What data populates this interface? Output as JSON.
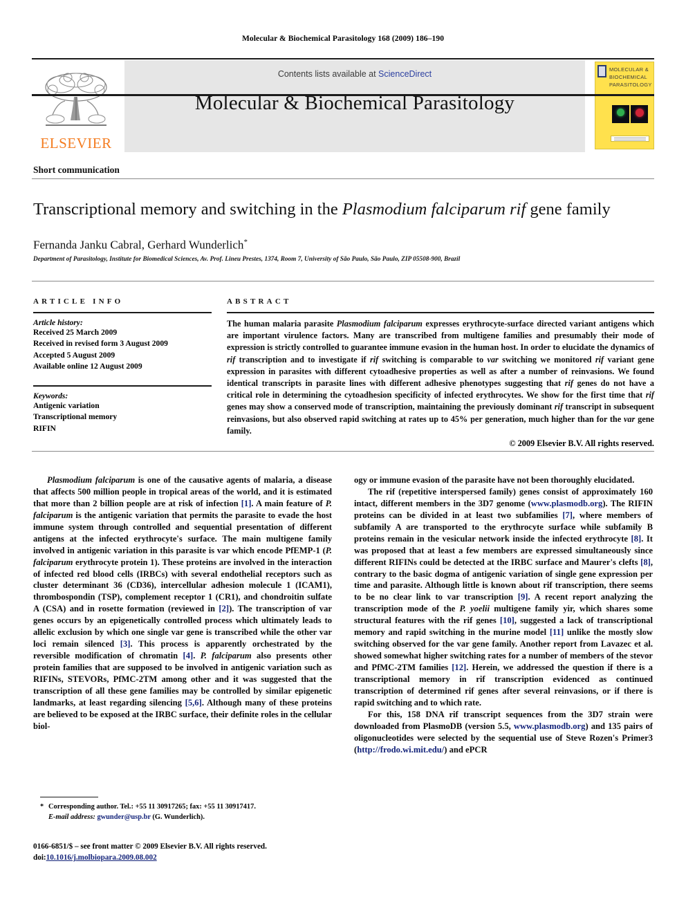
{
  "running_head": "Molecular & Biochemical Parasitology 168 (2009) 186–190",
  "masthead": {
    "publisher_name": "ELSEVIER",
    "contents_prefix": "Contents lists available at ",
    "sciencedirect": "ScienceDirect",
    "journal_title": "Molecular & Biochemical Parasitology",
    "cover_title": "MOLECULAR & BIOCHEMICAL PARASITOLOGY"
  },
  "article": {
    "type": "Short communication",
    "title_part1": "Transcriptional memory and switching in the ",
    "title_italic1": "Plasmodium falciparum rif",
    "title_part2": " gene family",
    "authors": "Fernanda Janku Cabral, Gerhard Wunderlich",
    "corresponding_marker": "*",
    "affiliation": "Department of Parasitology, Institute for Biomedical Sciences, Av. Prof. Lineu Prestes, 1374, Room 7, University of São Paulo, São Paulo, ZIP 05508-900, Brazil"
  },
  "info": {
    "heading": "ARTICLE INFO",
    "history_label": "Article history:",
    "history": [
      "Received 25 March 2009",
      "Received in revised form 3 August 2009",
      "Accepted 5 August 2009",
      "Available online 12 August 2009"
    ],
    "keywords_label": "Keywords:",
    "keywords": [
      "Antigenic variation",
      "Transcriptional memory",
      "RIFIN"
    ]
  },
  "abstract": {
    "heading": "ABSTRACT",
    "p1_a": "The human malaria parasite ",
    "p1_i1": "Plasmodium falciparum",
    "p1_b": " expresses erythrocyte-surface directed variant antigens which are important virulence factors. Many are transcribed from multigene families and presumably their mode of expression is strictly controlled to guarantee immune evasion in the human host. In order to elucidate the dynamics of ",
    "p1_i2": "rif",
    "p1_c": " transcription and to investigate if ",
    "p1_i3": "rif",
    "p1_d": " switching is comparable to ",
    "p1_i4": "var",
    "p1_e": " switching we monitored ",
    "p1_i5": "rif",
    "p1_f": " variant gene expression in parasites with different cytoadhesive properties as well as after a number of reinvasions. We found identical transcripts in parasite lines with different adhesive phenotypes suggesting that ",
    "p1_i6": "rif",
    "p1_g": " genes do not have a critical role in determining the cytoadhesion specificity of infected erythrocytes. We show for the first time that ",
    "p1_i7": "rif",
    "p1_h": " genes may show a conserved mode of transcription, maintaining the previously dominant ",
    "p1_i8": "rif",
    "p1_j": " transcript in subsequent reinvasions, but also observed rapid switching at rates up to 45% per generation, much higher than for the ",
    "p1_i9": "var",
    "p1_k": " gene family.",
    "copyright": "© 2009 Elsevier B.V. All rights reserved."
  },
  "body": {
    "left": {
      "p1_i1": "Plasmodium falciparum",
      "p1_a": " is one of the causative agents of malaria, a disease that affects 500 million people in tropical areas of the world, and it is estimated that more than 2 billion people are at risk of infection ",
      "p1_r1": "[1]",
      "p1_b": ". A main feature of ",
      "p1_i2": "P. falciparum",
      "p1_c": " is the antigenic variation that permits the parasite to evade the host immune system through controlled and sequential presentation of different antigens at the infected erythrocyte's surface. The main multigene family involved in antigenic variation in this parasite is var which encode PfEMP-1 (",
      "p1_i3": "P. falciparum",
      "p1_d": " erythrocyte protein 1). These proteins are involved in the interaction of infected red blood cells (IRBCs) with several endothelial receptors such as cluster determinant 36 (CD36), intercellular adhesion molecule 1 (ICAM1), thrombospondin (TSP), complement receptor 1 (CR1), and chondroitin sulfate A (CSA) and in rosette formation (reviewed in ",
      "p1_r2": "[2]",
      "p1_e": "). The transcription of var genes occurs by an epigenetically controlled process which ultimately leads to allelic exclusion by which one single var gene is transcribed while the other var loci remain silenced ",
      "p1_r3": "[3]",
      "p1_f": ". This process is apparently orchestrated by the reversible modification of chromatin ",
      "p1_r4": "[4]",
      "p1_g": ". ",
      "p1_i4": "P. falciparum",
      "p1_h": " also presents other protein families that are supposed to be involved in antigenic variation such as RIFINs, STEVORs, PfMC-2TM among other and it was suggested that the transcription of all these gene families may be controlled by similar epigenetic landmarks, at least regarding silencing ",
      "p1_r5": "[5,6]",
      "p1_i": ". Although many of these proteins are believed to be exposed at the IRBC surface, their definite roles in the cellular biol-"
    },
    "right": {
      "p1_cont": "ogy or immune evasion of the parasite have not been thoroughly elucidated.",
      "p2_a": "The rif (repetitive interspersed family) genes consist of approximately 160 intact, different members in the 3D7 genome (",
      "p2_l1": "www.plasmodb.org",
      "p2_b": "). The RIFIN proteins can be divided in at least two subfamilies ",
      "p2_r1": "[7]",
      "p2_c": ", where members of subfamily A are transported to the erythrocyte surface while subfamily B proteins remain in the vesicular network inside the infected erythrocyte ",
      "p2_r2": "[8]",
      "p2_d": ". It was proposed that at least a few members are expressed simultaneously since different RIFINs could be detected at the IRBC surface and Maurer's clefts ",
      "p2_r3": "[8]",
      "p2_e": ", contrary to the basic dogma of antigenic variation of single gene expression per time and parasite. Although little is known about rif transcription, there seems to be no clear link to var transcription ",
      "p2_r4": "[9]",
      "p2_f": ". A recent report analyzing the transcription mode of the ",
      "p2_i1": "P. yoelii",
      "p2_g": " multigene family yir, which shares some structural features with the rif genes ",
      "p2_r5": "[10]",
      "p2_h": ", suggested a lack of transcriptional memory and rapid switching in the murine model ",
      "p2_r6": "[11]",
      "p2_i": " unlike the mostly slow switching observed for the var gene family. Another report from Lavazec et al. showed somewhat higher switching rates for a number of members of the stevor and PfMC-2TM families ",
      "p2_r7": "[12]",
      "p2_j": ". Herein, we addressed the question if there is a transcriptional memory in rif transcription evidenced as continued transcription of determined rif genes after several reinvasions, or if there is rapid switching and to which rate.",
      "p3_a": "For this, 158 DNA rif transcript sequences from the 3D7 strain were downloaded from PlasmoDB (version 5.5, ",
      "p3_l1": "www.plasmodb.org",
      "p3_b": ") and 135 pairs of oligonucleotides were selected by the sequential use of Steve Rozen's Primer3 (",
      "p3_l2": "http://frodo.wi.mit.edu/",
      "p3_c": ") and ePCR"
    }
  },
  "footnote": {
    "marker": "*",
    "text_a": "Corresponding author. Tel.: +55 11 30917265; fax: +55 11 30917417.",
    "email_label": "E-mail address:",
    "email": "gwunder@usp.br",
    "email_suffix": " (G. Wunderlich)."
  },
  "footer": {
    "issn_line": "0166-6851/$ – see front matter © 2009 Elsevier B.V. All rights reserved.",
    "doi_label": "doi:",
    "doi_value": "10.1016/j.molbiopara.2009.08.002"
  },
  "colors": {
    "link": "#14247a",
    "sciencedirect": "#2b3fa0",
    "elsevier_orange": "#F47C20",
    "cover_yellow": "#FFE14D",
    "band_gray": "#e6e6e6"
  }
}
